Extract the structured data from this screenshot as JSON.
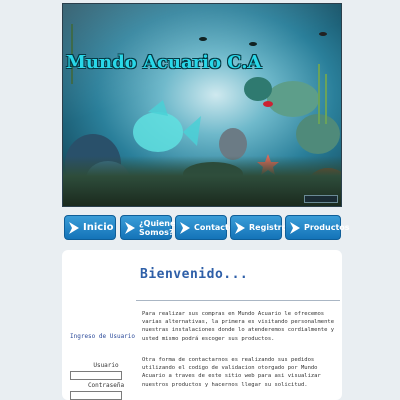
{
  "header": {
    "title": "Mundo Acuario C.A"
  },
  "nav": {
    "items": [
      {
        "label": "Inicio"
      },
      {
        "label": "¿Quienes Somos?"
      },
      {
        "label": "Contacto"
      },
      {
        "label": "Registro"
      },
      {
        "label": "Productos"
      }
    ]
  },
  "login": {
    "title": "Ingreso de Usuario",
    "user_label": "Usuario",
    "user_value": "",
    "password_label": "Contraseña",
    "password_value": ""
  },
  "main": {
    "heading": "Bienvenido...",
    "paragraphs": [
      "Para realizar sus compras en Mundo Acuario le ofrecemos varias alternativas, la primera es visitando personalmente nuestras instalaciones donde lo atenderemos cordialmente y usted mismo podrá escoger sus productos.",
      "Otra forma de contactarnos es realizando sus pedidos utilizando el codigo de validacion otorgado por Mundo Acuario a traves de este sitio web para asi visualizar nuestros productos y hacernos llegar su solicitud."
    ]
  },
  "colors": {
    "nav_button": "#1f86c9",
    "title_text": "#29d7e8",
    "heading": "#2e5fa8"
  }
}
